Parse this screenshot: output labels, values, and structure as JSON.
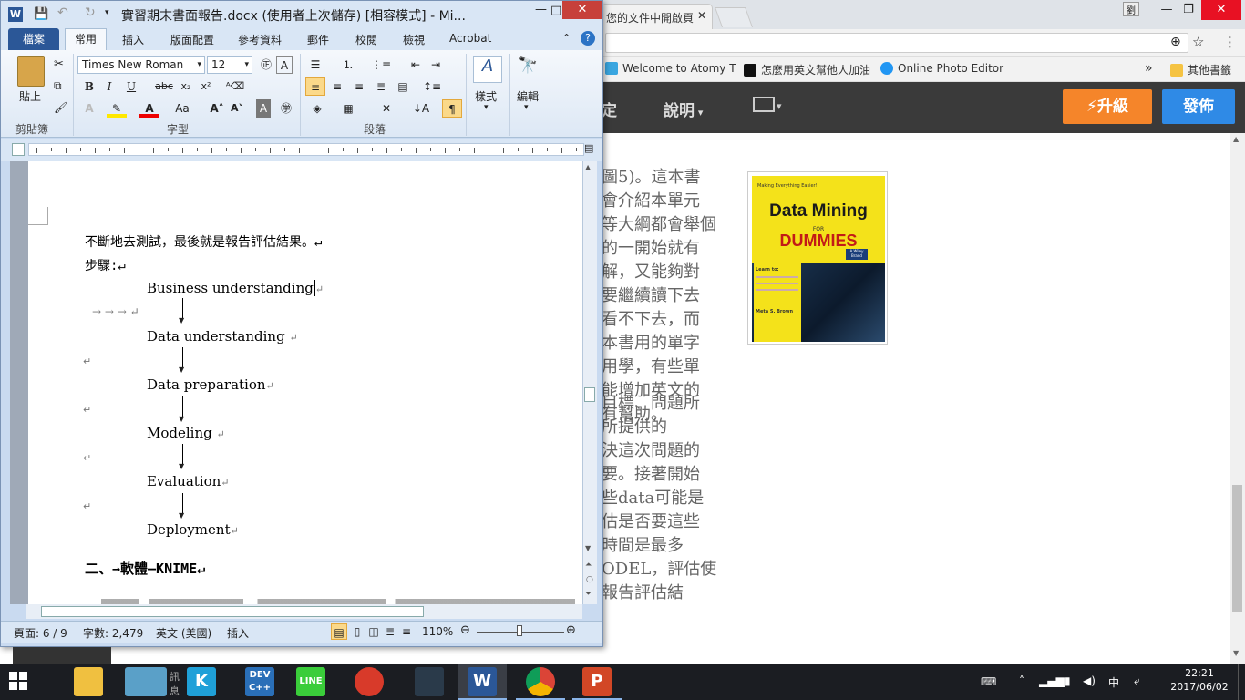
{
  "chrome": {
    "tab2_title": "您的文件中開啟頁",
    "bookmarks": [
      "Welcome to Atomy T",
      "怎麼用英文幫他人加油",
      "Online Photo Editor"
    ],
    "other_bookmarks": "其他書籤",
    "more": "»",
    "user_badge": "劉"
  },
  "website": {
    "nav_fixed": "定",
    "nav_help": "說明",
    "upgrade": "升級",
    "publish": "發佈",
    "bg_lines_1": [
      "圖5)。這本書",
      "會介紹本單元",
      "等大綱都會舉個",
      "的一開始就有",
      "解，又能夠對",
      "要繼續讀下去",
      "看不下去，而",
      "本書用的單字",
      "用學，有些單",
      "能增加英文的",
      "有幫助。"
    ],
    "bg_lines_2": [
      "目標、問題所",
      "所提供的",
      "決這次問題的",
      "要。接著開始",
      "些data可能是",
      "估是否要這些",
      "時間是最多",
      "ODEL，評估使",
      "報告評估結"
    ],
    "book": {
      "tagline": "Making Everything Easier!",
      "title": "Data Mining",
      "for": "FOR",
      "series": "DUMMIES",
      "badge": "A Wiley Brand",
      "learn": "Learn to:",
      "author": "Meta S. Brown"
    }
  },
  "word": {
    "title": "實習期末書面報告.docx (使用者上次儲存) [相容模式] - Mi...",
    "tabs": [
      "檔案",
      "常用",
      "插入",
      "版面配置",
      "參考資料",
      "郵件",
      "校閱",
      "檢視",
      "Acrobat"
    ],
    "clipboard": {
      "paste": "貼上",
      "label": "剪貼簿"
    },
    "font": {
      "name": "Times New Roman",
      "size": "12",
      "label": "字型"
    },
    "paragraph_label": "段落",
    "styles": {
      "label": "樣式"
    },
    "editing": {
      "label": "編輯"
    },
    "doc": {
      "line1": "不斷地去測試，最後就是報告評估結果。↵",
      "steps": "步驟:↵",
      "items": [
        "Business understanding",
        "Data understanding",
        "Data preparation",
        "Modeling",
        "Evaluation",
        "Deployment"
      ],
      "tabs_row": "→    →    →   ↵",
      "heading": "二、→軟體—KNIME↵"
    },
    "status": {
      "page": "頁面: 6 / 9",
      "words": "字數: 2,479",
      "lang": "英文 (美國)",
      "mode": "插入",
      "zoom": "110%"
    }
  },
  "taskbar": {
    "time": "22:21",
    "date": "2017/06/02",
    "ime": "中",
    "notif_text": "訊息"
  }
}
